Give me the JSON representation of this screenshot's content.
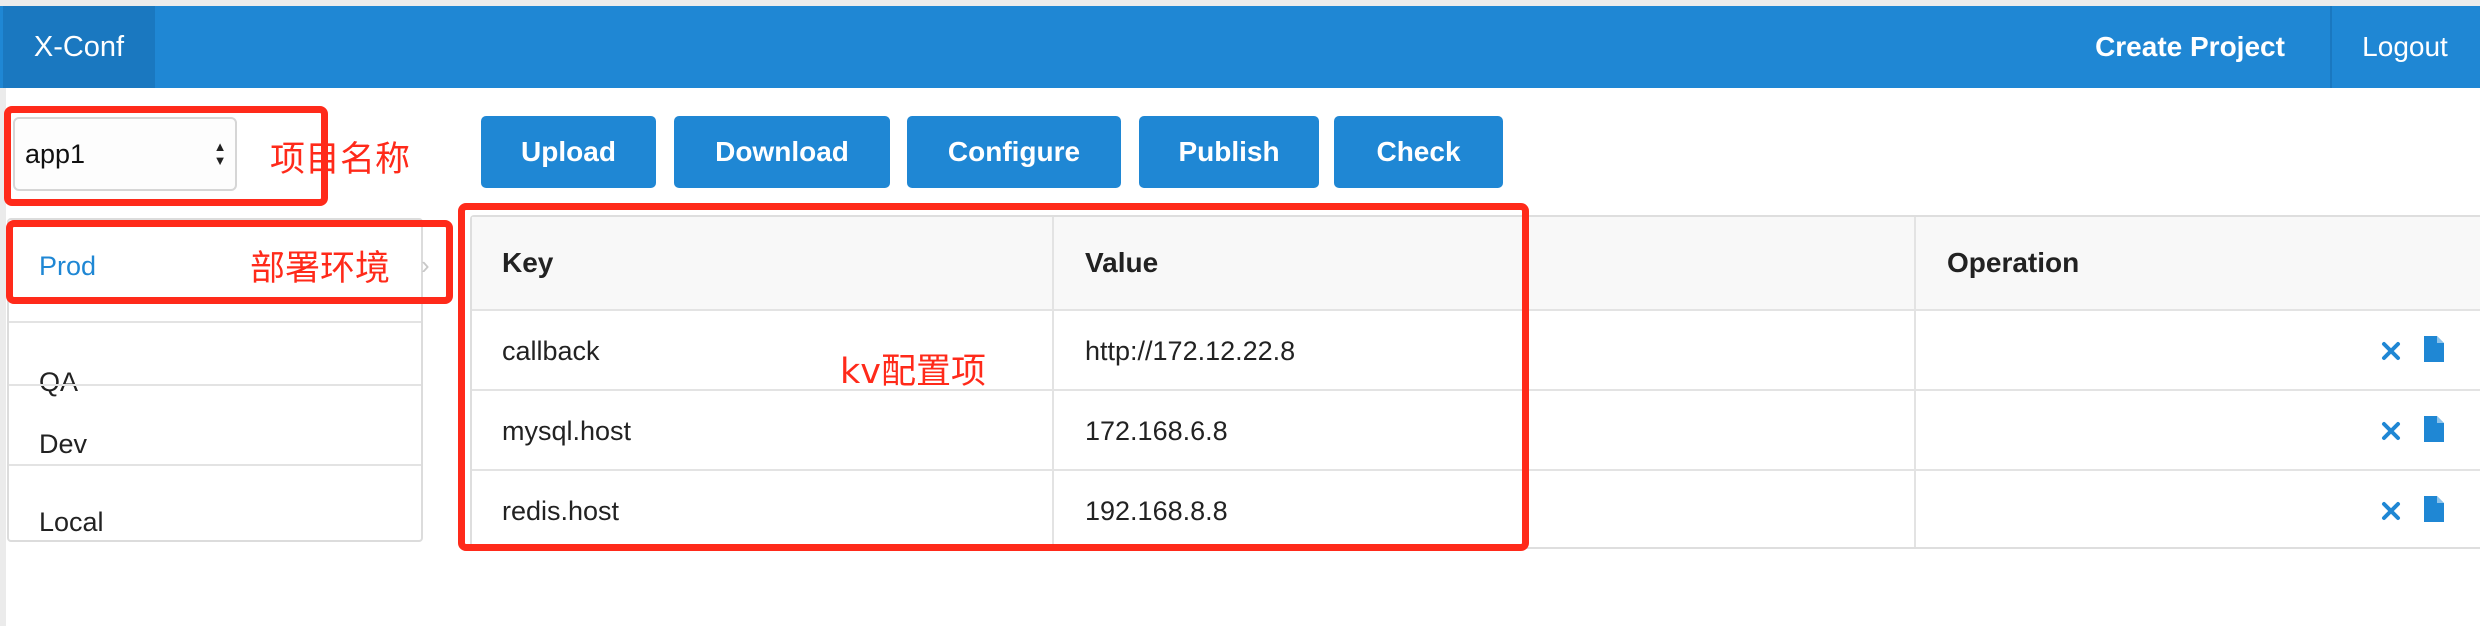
{
  "navbar": {
    "brand": "X-Conf",
    "create_project": "Create Project",
    "logout": "Logout"
  },
  "project_select": {
    "value": "app1",
    "annotation": "项目名称"
  },
  "toolbar": {
    "buttons": [
      "Upload",
      "Download",
      "Configure",
      "Publish",
      "Check"
    ]
  },
  "environments": {
    "items": [
      "Prod",
      "QA",
      "Dev",
      "Local"
    ],
    "selected": "Prod",
    "annotation": "部署环境"
  },
  "table": {
    "headers": [
      "Key",
      "Value",
      "Operation"
    ],
    "rows": [
      {
        "key": "callback",
        "value": "http://172.12.22.8"
      },
      {
        "key": "mysql.host",
        "value": "172.168.6.8"
      },
      {
        "key": "redis.host",
        "value": "192.168.8.8"
      }
    ],
    "annotation": "kv配置项",
    "row_actions": [
      "delete-icon",
      "file-icon"
    ]
  },
  "colors": {
    "primary": "#1f87d4",
    "annotation_red": "#ff2a1a"
  }
}
